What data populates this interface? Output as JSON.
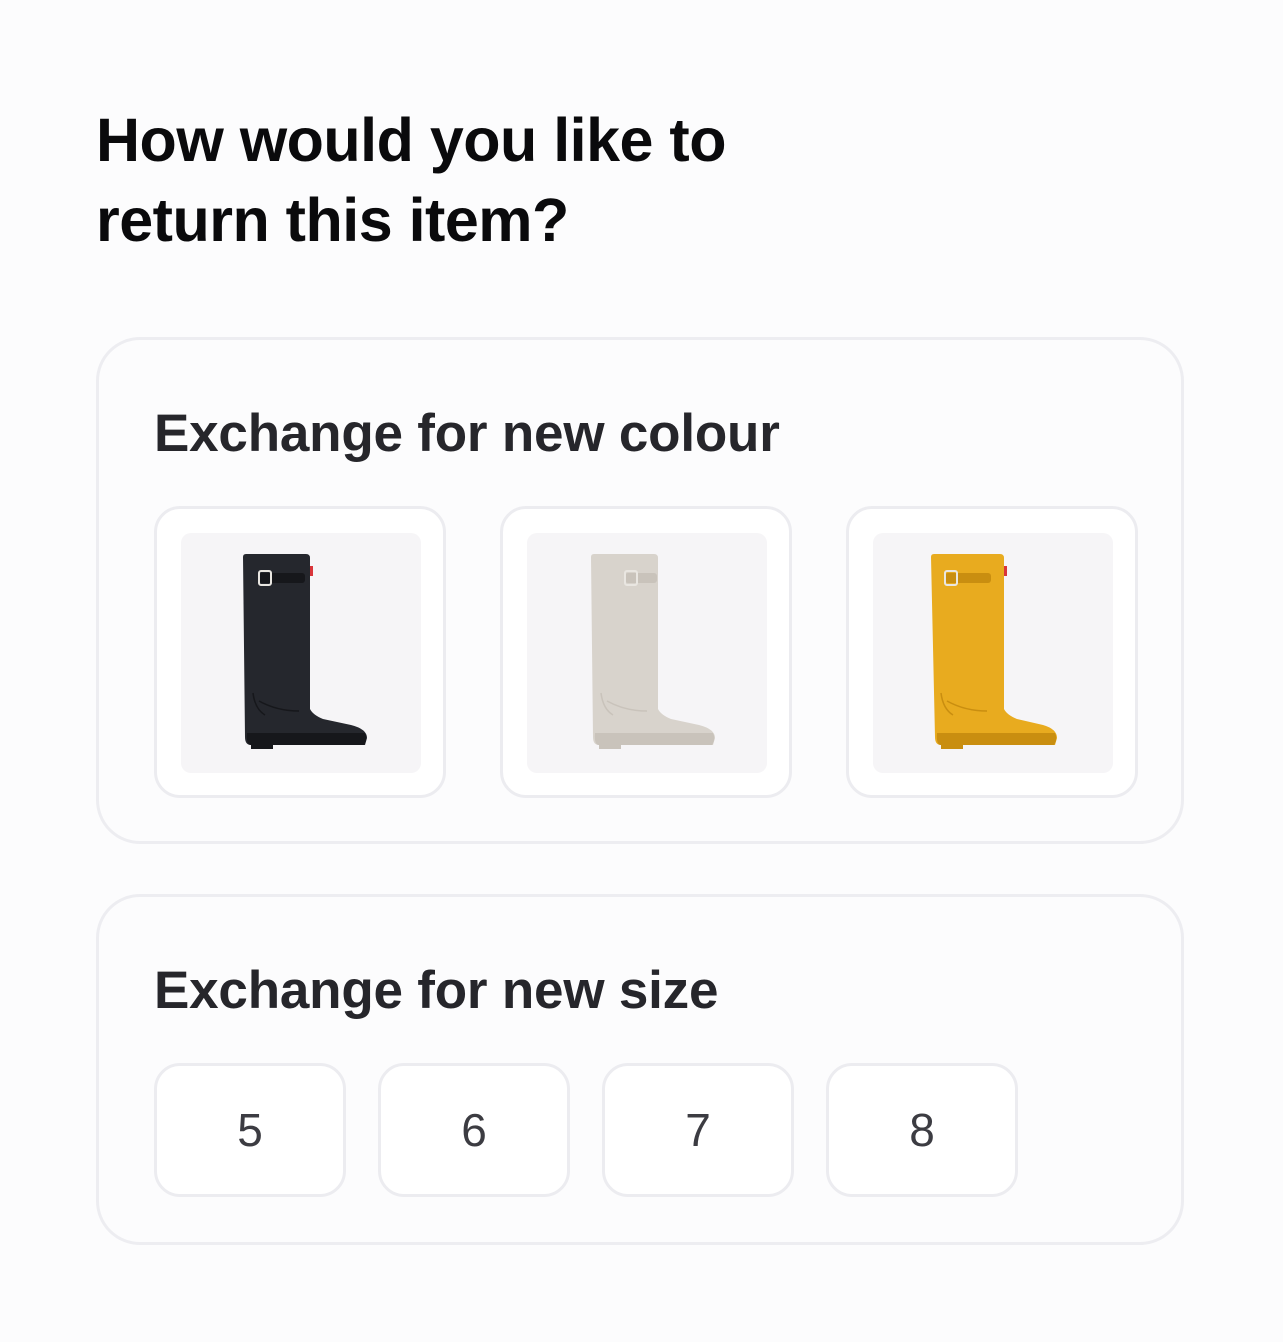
{
  "page": {
    "title": "How would you like to return this item?"
  },
  "colour_section": {
    "title": "Exchange for new colour",
    "options": [
      {
        "name": "black",
        "boot_color": "#25272d",
        "sole_color": "#16171b"
      },
      {
        "name": "off-white",
        "boot_color": "#d8d3cc",
        "sole_color": "#c9c3bb"
      },
      {
        "name": "yellow",
        "boot_color": "#e8ab1f",
        "sole_color": "#c98e10"
      }
    ]
  },
  "size_section": {
    "title": "Exchange for new size",
    "options": [
      "5",
      "6",
      "7",
      "8"
    ]
  }
}
